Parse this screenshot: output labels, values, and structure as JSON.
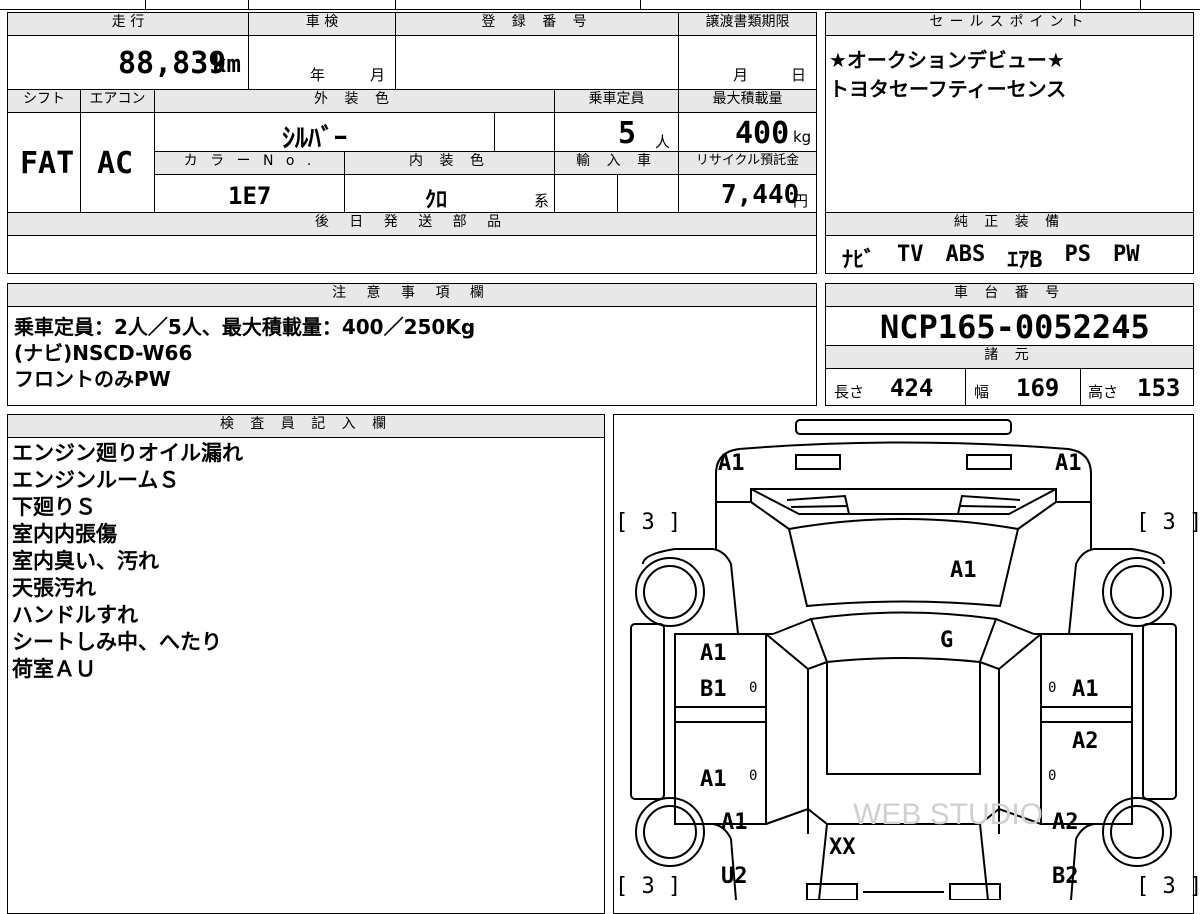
{
  "vehicle": {
    "mileage_header": "走 行",
    "mileage_value": "88,839",
    "mileage_unit": "km",
    "inspection_header": "車 検",
    "inspection_year": "年",
    "inspection_month": "月",
    "registration_header": "登 録 番 号",
    "registration_value": "",
    "transfer_header": "譲渡書類期限",
    "transfer_month": "月",
    "transfer_day": "日",
    "shift_header": "シフト",
    "shift_value": "FAT",
    "ac_header": "エアコン",
    "ac_value": "AC",
    "exterior_header": "外 装 色",
    "exterior_value": "ｼﾙﾊﾞｰ",
    "capacity_header": "乗車定員",
    "capacity_value": "5",
    "capacity_unit": "人",
    "max_load_header": "最大積載量",
    "max_load_value": "400",
    "max_load_unit": "kg",
    "color_no_header": "カ ラ ー N o .",
    "color_no_value": "1E7",
    "interior_header": "内 装 色",
    "interior_value": "ｸﾛ",
    "interior_suffix": "系",
    "import_header": "輸 入 車",
    "recycle_header": "リサイクル預託金",
    "recycle_value": "7,440",
    "recycle_unit": "円",
    "later_parts_header": "後 日 発 送 部 品"
  },
  "sales": {
    "header": "セールスポイント",
    "lines": [
      "★オークションデビュー★",
      "トヨタセーフティーセンス"
    ]
  },
  "equipment": {
    "header": "純 正 装 備",
    "items": [
      "ﾅﾋﾞ",
      "TV",
      "ABS",
      "ｴｱB",
      "PS",
      "PW"
    ]
  },
  "notes": {
    "header": "注 意 事 項 欄",
    "lines": [
      "乗車定員：2人／5人、最大積載量：400／250Kg",
      "(ナビ)NSCD-W66",
      "フロントのみPW"
    ]
  },
  "chassis": {
    "header": "車 台 番 号",
    "value": "NCP165-0052245"
  },
  "specs": {
    "header": "諸 元",
    "length_label": "長さ",
    "length_value": "424",
    "width_label": "幅",
    "width_value": "169",
    "height_label": "高さ",
    "height_value": "153"
  },
  "inspector": {
    "header": "検 査 員 記 入 欄",
    "lines": [
      "エンジン廻りオイル漏れ",
      "エンジンルームＳ",
      "下廻りＳ",
      "室内内張傷",
      "室内臭い、汚れ",
      "天張汚れ",
      "ハンドルすれ",
      "シートしみ中、へたり",
      "荷室ＡＵ"
    ]
  },
  "diagram": {
    "marks": {
      "front_left": "A1",
      "front_right": "A1",
      "hood": "A1",
      "windshield": "G",
      "left_front_door_upper": "A1",
      "left_front_door_lower": "B1",
      "left_rear_door": "A1",
      "left_rear_fender": "A1",
      "left_rear_corner": "U2",
      "right_front_door": "A1",
      "right_rear_door": "A2",
      "right_rear_fender": "A2",
      "right_rear_corner": "B2",
      "rear": "XX",
      "tire_fl": "[ 3 ]",
      "tire_fr": "[ 3 ]",
      "tire_rl": "[ 3 ]",
      "tire_rr": "[ 3 ]",
      "zero_1": "0",
      "zero_2": "0",
      "zero_3": "0",
      "zero_4": "0"
    },
    "watermark": "WEB STUDIO"
  }
}
